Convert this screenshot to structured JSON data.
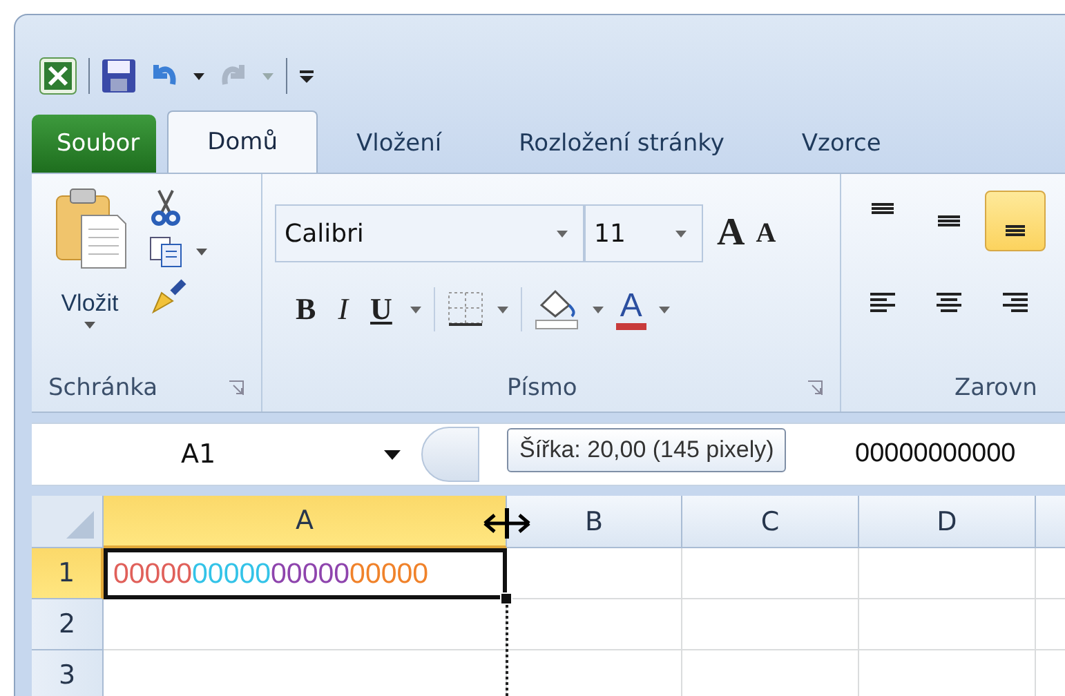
{
  "tabs": [
    {
      "label": "Soubor",
      "kind": "file",
      "selected": false
    },
    {
      "label": "Domů",
      "kind": "tab",
      "selected": true
    },
    {
      "label": "Vložení",
      "kind": "tab",
      "selected": false
    },
    {
      "label": "Rozložení stránky",
      "kind": "tab",
      "selected": false
    },
    {
      "label": "Vzorce",
      "kind": "tab",
      "selected": false
    }
  ],
  "clipboard": {
    "paste_label": "Vložit",
    "group_label": "Schránka"
  },
  "font": {
    "font_name": "Calibri",
    "font_size": "11",
    "grow": "A",
    "shrink": "A",
    "bold": "B",
    "italic": "I",
    "underline": "U",
    "font_color": "A",
    "group_label": "Písmo"
  },
  "alignment": {
    "group_label": "Zarovn",
    "buttons": [
      {
        "kind": "top",
        "selected": false
      },
      {
        "kind": "middle",
        "selected": false
      },
      {
        "kind": "bottom",
        "selected": true
      },
      {
        "kind": "left",
        "selected": false
      },
      {
        "kind": "center",
        "selected": false
      },
      {
        "kind": "right",
        "selected": false
      }
    ]
  },
  "name_box": "A1",
  "formula": "00000000000",
  "tooltip": "Šířka: 20,00 (145 pixely)",
  "columns": [
    {
      "label": "A",
      "selected": true
    },
    {
      "label": "B",
      "selected": false
    },
    {
      "label": "C",
      "selected": false
    },
    {
      "label": "D",
      "selected": false
    }
  ],
  "rows": [
    {
      "label": "1",
      "selected": true,
      "cell_a": [
        {
          "text": "00000",
          "color": "#e0605a"
        },
        {
          "text": "00000",
          "color": "#33c3e8"
        },
        {
          "text": "00000",
          "color": "#8e44ad"
        },
        {
          "text": "00000",
          "color": "#f0822a"
        }
      ]
    },
    {
      "label": "2",
      "selected": false,
      "cell_a": []
    },
    {
      "label": "3",
      "selected": false,
      "cell_a": []
    }
  ]
}
